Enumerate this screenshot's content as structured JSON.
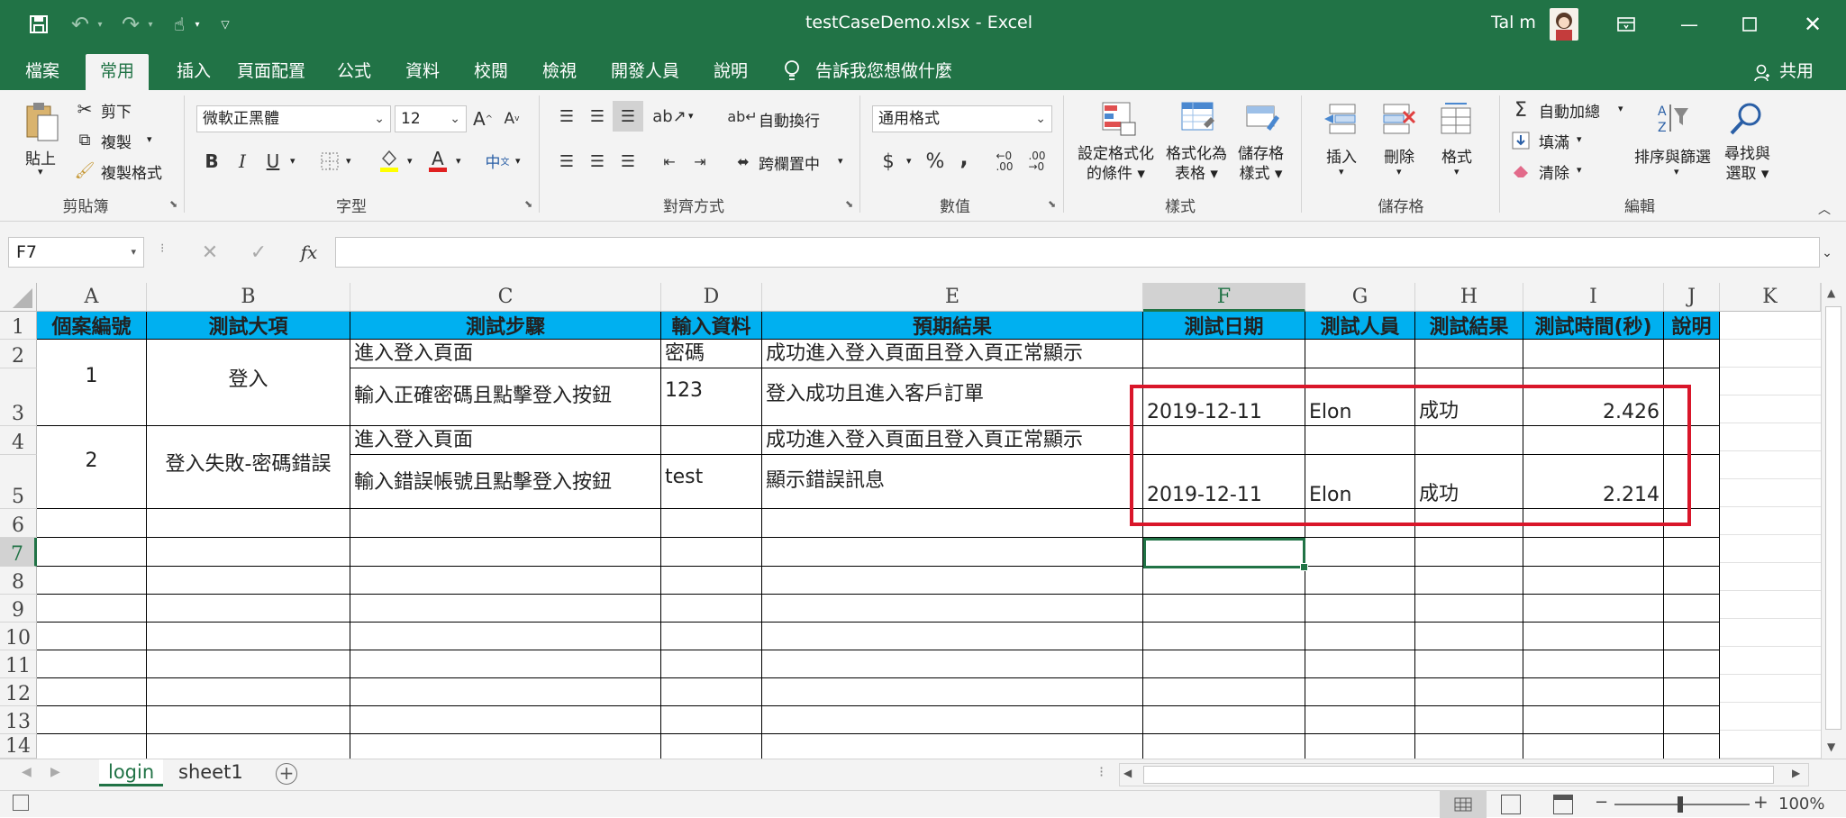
{
  "window": {
    "title": "testCaseDemo.xlsx  -  Excel",
    "user": "Tal m",
    "share_label": "共用"
  },
  "tabs": [
    "檔案",
    "常用",
    "插入",
    "頁面配置",
    "公式",
    "資料",
    "校閱",
    "檢視",
    "開發人員",
    "說明"
  ],
  "active_tab": "常用",
  "tell_me": "告訴我您想做什麼",
  "ribbon": {
    "clipboard": {
      "paste": "貼上",
      "cut": "剪下",
      "copy": "複製",
      "format_painter": "複製格式",
      "label": "剪貼簿"
    },
    "font": {
      "name": "微軟正黑體",
      "size": "12",
      "label": "字型",
      "bold": "B",
      "italic": "I",
      "underline": "U"
    },
    "alignment": {
      "wrap": "自動換行",
      "merge": "跨欄置中",
      "label": "對齊方式"
    },
    "number": {
      "format": "通用格式",
      "currency": "$",
      "percent": "%",
      "comma": ",",
      "label": "數值"
    },
    "styles": {
      "conditional": "設定格式化\n的條件",
      "table": "格式化為\n表格",
      "cell_styles": "儲存格\n樣式",
      "label": "樣式"
    },
    "cells": {
      "insert": "插入",
      "delete": "刪除",
      "format": "格式",
      "label": "儲存格"
    },
    "editing": {
      "autosum": "自動加總",
      "fill": "填滿",
      "clear": "清除",
      "sort": "排序與篩選",
      "find": "尋找與\n選取",
      "label": "編輯"
    }
  },
  "formula_bar": {
    "name_box": "F7",
    "formula": "",
    "fx": "fx"
  },
  "columns": [
    "A",
    "B",
    "C",
    "D",
    "E",
    "F",
    "G",
    "H",
    "I",
    "J",
    "K"
  ],
  "rows": [
    "1",
    "2",
    "3",
    "4",
    "5",
    "6",
    "7",
    "8",
    "9",
    "10",
    "11",
    "12",
    "13",
    "14"
  ],
  "selected_cell": "F7",
  "headers": {
    "A": "個案編號",
    "B": "測試大項",
    "C": "測試步驟",
    "D": "輸入資料",
    "E": "預期結果",
    "F": "測試日期",
    "G": "測試人員",
    "H": "測試結果",
    "I": "測試時間(秒)",
    "J": "說明"
  },
  "cells": {
    "A2": "1",
    "B2": "登入",
    "C2": "進入登入頁面",
    "D2": "密碼",
    "E2": "成功進入登入頁面且登入頁正常顯示",
    "C3": "輸入正確密碼且點擊登入按鈕",
    "D3": "123",
    "E3": "登入成功且進入客戶訂單",
    "F3": "2019-12-11",
    "G3": "Elon",
    "H3": "成功",
    "I3": "2.426",
    "A4": "2",
    "B4": "登入失敗-密碼錯誤",
    "C4": "進入登入頁面",
    "E4": "成功進入登入頁面且登入頁正常顯示",
    "C5": "輸入錯誤帳號且點擊登入按鈕",
    "D5": "test",
    "E5": "顯示錯誤訊息",
    "F5": "2019-12-11",
    "G5": "Elon",
    "H5": "成功",
    "I5": "2.214"
  },
  "sheet_tabs": [
    "login",
    "sheet1"
  ],
  "active_sheet": "login",
  "status": {
    "zoom": "100%"
  },
  "colors": {
    "excel_green": "#217346",
    "header_fill": "#00b0f0",
    "highlight_box": "#d9162a"
  }
}
